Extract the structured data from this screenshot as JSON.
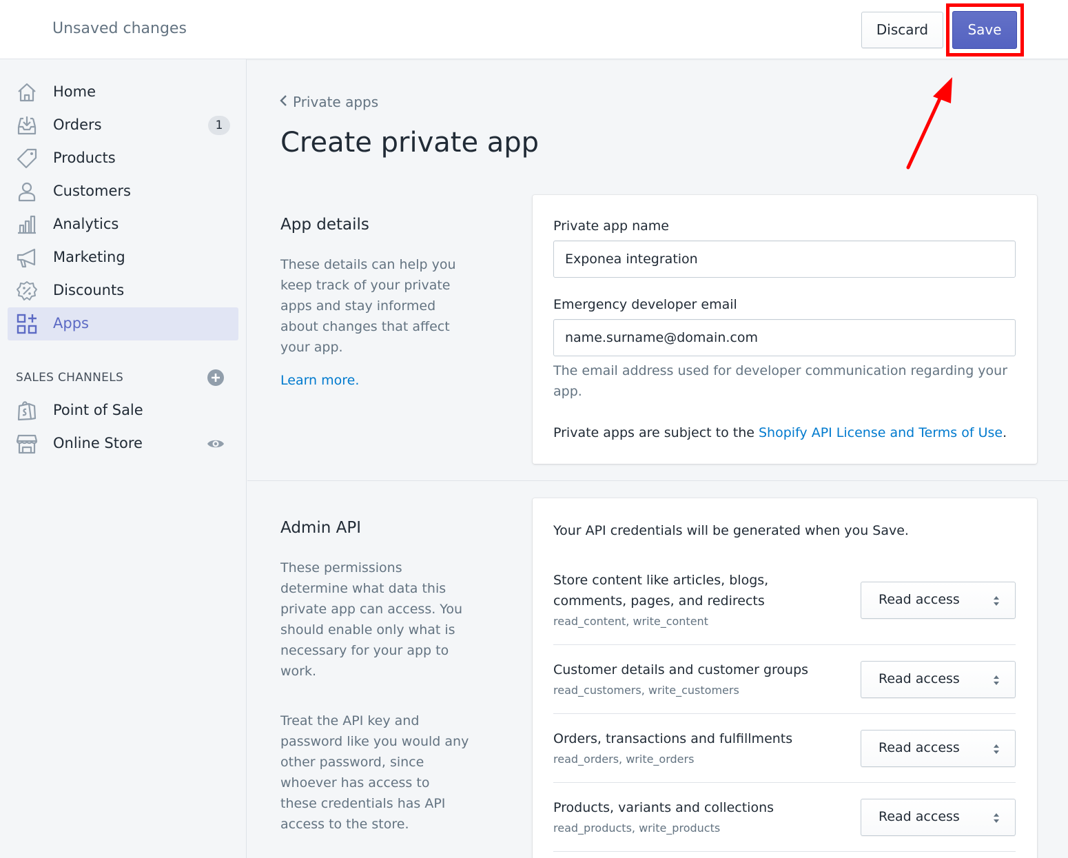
{
  "topbar": {
    "title": "Unsaved changes",
    "discard_label": "Discard",
    "save_label": "Save"
  },
  "sidebar": {
    "items": [
      {
        "label": "Home",
        "icon": "home-icon"
      },
      {
        "label": "Orders",
        "icon": "orders-icon",
        "badge": "1"
      },
      {
        "label": "Products",
        "icon": "tag-icon"
      },
      {
        "label": "Customers",
        "icon": "person-icon"
      },
      {
        "label": "Analytics",
        "icon": "bar-chart-icon"
      },
      {
        "label": "Marketing",
        "icon": "megaphone-icon"
      },
      {
        "label": "Discounts",
        "icon": "discount-icon"
      },
      {
        "label": "Apps",
        "icon": "apps-icon",
        "active": true
      }
    ],
    "sales_channels_label": "SALES CHANNELS",
    "channels": [
      {
        "label": "Point of Sale",
        "icon": "shopping-bag-icon"
      },
      {
        "label": "Online Store",
        "icon": "store-icon"
      }
    ]
  },
  "main": {
    "breadcrumb": "Private apps",
    "title": "Create private app",
    "app_details": {
      "title": "App details",
      "description": "These details can help you keep track of your private apps and stay informed about changes that affect your app.",
      "learn_more": "Learn more.",
      "name_label": "Private app name",
      "name_value": "Exponea integration",
      "email_label": "Emergency developer email",
      "email_value": "name.surname@domain.com",
      "email_help": "The email address used for developer communication regarding your app.",
      "terms_prefix": "Private apps are subject to the ",
      "terms_link": "Shopify API License and Terms of Use",
      "terms_suffix": "."
    },
    "admin_api": {
      "title": "Admin API",
      "description1": "These permissions determine what data this private app can access. You should enable only what is necessary for your app to work.",
      "description2": "Treat the API key and password like you would any other password, since whoever has access to these credentials has API access to the store.",
      "credentials_note": "Your API credentials will be generated when you Save.",
      "permissions": [
        {
          "title": "Store content like articles, blogs, comments, pages, and redirects",
          "scopes": "read_content, write_content",
          "access": "Read access"
        },
        {
          "title": "Customer details and customer groups",
          "scopes": "read_customers, write_customers",
          "access": "Read access"
        },
        {
          "title": "Orders, transactions and fulfillments",
          "scopes": "read_orders, write_orders",
          "access": "Read access"
        },
        {
          "title": "Products, variants and collections",
          "scopes": "read_products, write_products",
          "access": "Read access"
        }
      ]
    }
  },
  "colors": {
    "accent": "#5c6ac4",
    "link": "#007ace",
    "highlight": "#ff0000"
  }
}
